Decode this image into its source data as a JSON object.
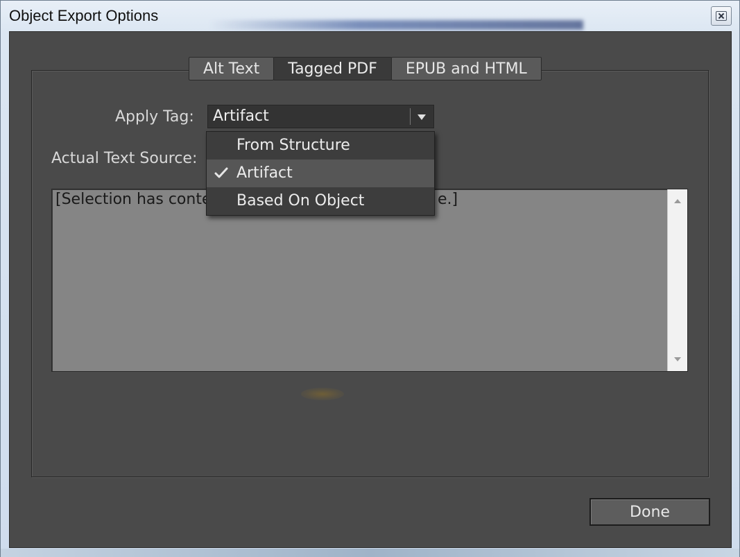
{
  "window": {
    "title": "Object Export Options"
  },
  "tabs": [
    {
      "label": "Alt Text",
      "active": false
    },
    {
      "label": "Tagged PDF",
      "active": true
    },
    {
      "label": "EPUB and HTML",
      "active": false
    }
  ],
  "apply_tag": {
    "label": "Apply Tag:",
    "value": "Artifact",
    "options": [
      {
        "label": "From Structure",
        "checked": false
      },
      {
        "label": "Artifact",
        "checked": true
      },
      {
        "label": "Based On Object",
        "checked": false
      }
    ]
  },
  "actual_text": {
    "label": "Actual Text Source:",
    "content_prefix": "[Selection has conte",
    "content_suffix": "e.]"
  },
  "done_label": "Done",
  "icons": {
    "close": "close-icon",
    "dropdown": "chevron-down-icon",
    "check": "checkmark-icon",
    "scroll_up": "scroll-up-arrow-icon",
    "scroll_down": "scroll-down-arrow-icon"
  }
}
